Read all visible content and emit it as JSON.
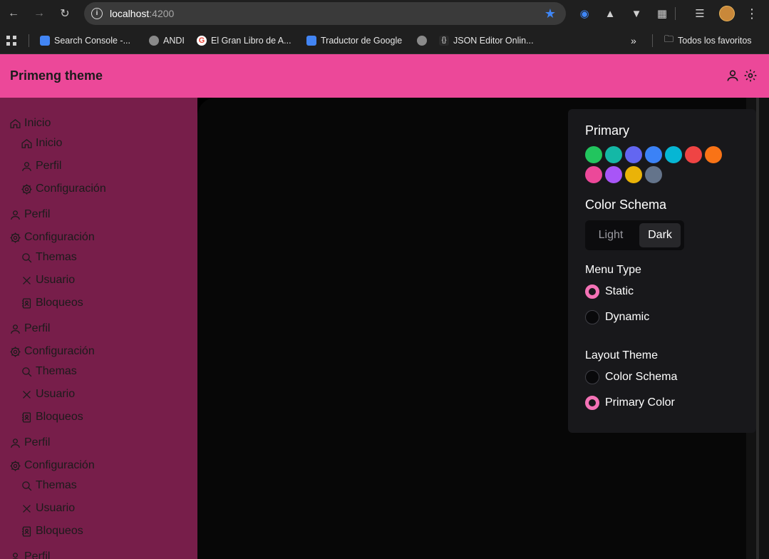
{
  "browser": {
    "url_host": "localhost",
    "url_port": ":4200",
    "bookmarks": [
      {
        "label": "Search Console -...",
        "icon": "search-console-icon"
      },
      {
        "label": "ANDI",
        "icon": "globe-icon"
      },
      {
        "label": "El Gran Libro de A...",
        "icon": "google-icon"
      },
      {
        "label": "Traductor de Google",
        "icon": "translate-icon"
      },
      {
        "label": "",
        "icon": "globe-icon"
      },
      {
        "label": "JSON Editor Onlin...",
        "icon": "json-icon"
      }
    ],
    "all_bookmarks": "Todos los favoritos"
  },
  "app": {
    "title": "Primeng theme",
    "accent": "#ec4899",
    "sidebar_bg": "#771e4a"
  },
  "sidebar": {
    "items": [
      {
        "label": "Inicio",
        "icon": "home-icon",
        "level": 0
      },
      {
        "label": "Inicio",
        "icon": "home-icon",
        "level": 1
      },
      {
        "label": "Perfil",
        "icon": "user-icon",
        "level": 1
      },
      {
        "label": "Configuración",
        "icon": "gear-icon",
        "level": 1
      },
      {
        "label": "Perfil",
        "icon": "user-icon",
        "level": 0
      },
      {
        "label": "Configuración",
        "icon": "gear-icon",
        "level": 0
      },
      {
        "label": "Themas",
        "icon": "search-icon",
        "level": 1
      },
      {
        "label": "Usuario",
        "icon": "close-icon",
        "level": 1
      },
      {
        "label": "Bloqueos",
        "icon": "contact-book-icon",
        "level": 1
      },
      {
        "label": "Perfil",
        "icon": "user-icon",
        "level": 0
      },
      {
        "label": "Configuración",
        "icon": "gear-icon",
        "level": 0
      },
      {
        "label": "Themas",
        "icon": "search-icon",
        "level": 1
      },
      {
        "label": "Usuario",
        "icon": "close-icon",
        "level": 1
      },
      {
        "label": "Bloqueos",
        "icon": "contact-book-icon",
        "level": 1
      },
      {
        "label": "Perfil",
        "icon": "user-icon",
        "level": 0
      },
      {
        "label": "Configuración",
        "icon": "gear-icon",
        "level": 0
      },
      {
        "label": "Themas",
        "icon": "search-icon",
        "level": 1
      },
      {
        "label": "Usuario",
        "icon": "close-icon",
        "level": 1
      },
      {
        "label": "Bloqueos",
        "icon": "contact-book-icon",
        "level": 1
      },
      {
        "label": "Perfil",
        "icon": "user-icon",
        "level": 0
      }
    ]
  },
  "config": {
    "primary_title": "Primary",
    "primary_colors": [
      "#22c55e",
      "#14b8a6",
      "#6366f1",
      "#3b82f6",
      "#06b6d4",
      "#ef4444",
      "#f97316",
      "#ec4899",
      "#a855f7",
      "#eab308",
      "#64748b"
    ],
    "color_schema_title": "Color Schema",
    "color_schema_options": {
      "light": "Light",
      "dark": "Dark"
    },
    "color_schema_selected": "Dark",
    "menu_type_title": "Menu Type",
    "menu_type_options": [
      "Static",
      "Dynamic"
    ],
    "menu_type_selected": "Static",
    "layout_theme_title": "Layout Theme",
    "layout_theme_options": [
      "Color Schema",
      "Primary Color"
    ],
    "layout_theme_selected": "Primary Color",
    "radio_accent": "#f472b6"
  }
}
